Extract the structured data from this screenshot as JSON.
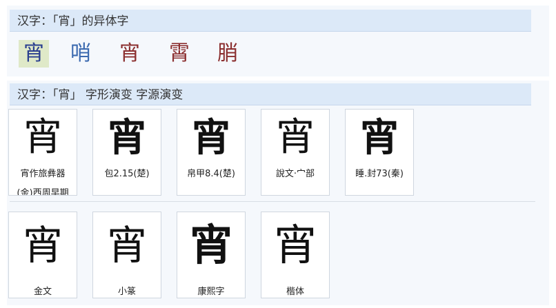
{
  "variants_section": {
    "title": "汉字：「宵」的异体字",
    "variants": [
      {
        "char": "宵",
        "color": "#2a3f8f",
        "bg": "#dfe9c8"
      },
      {
        "char": "哨",
        "color": "#3d6bb0",
        "bg": "transparent"
      },
      {
        "char": "宵",
        "color": "#8b2f2f",
        "bg": "transparent"
      },
      {
        "char": "霄",
        "color": "#8b2f2f",
        "bg": "transparent"
      },
      {
        "char": "䏴",
        "color": "#8b2f2f",
        "bg": "transparent"
      }
    ]
  },
  "evolution_section": {
    "title": "汉字：「宵」 字形演变 字源演变",
    "row1": [
      {
        "glyph": "宵",
        "caption": "宵作旅彝器",
        "caption2": "(金)西周早期"
      },
      {
        "glyph": "宵",
        "caption": "包2.15(楚)"
      },
      {
        "glyph": "宵",
        "caption": "帛甲8.4(楚)"
      },
      {
        "glyph": "宵",
        "caption": "說文‧宀部"
      },
      {
        "glyph": "宵",
        "caption": "睡.封73(秦)"
      }
    ],
    "row2": [
      {
        "glyph": "宵",
        "caption": "金文"
      },
      {
        "glyph": "宵",
        "caption": "小篆"
      },
      {
        "glyph": "宵",
        "caption": "康熙字"
      },
      {
        "glyph": "宵",
        "caption": "楷体"
      }
    ]
  }
}
